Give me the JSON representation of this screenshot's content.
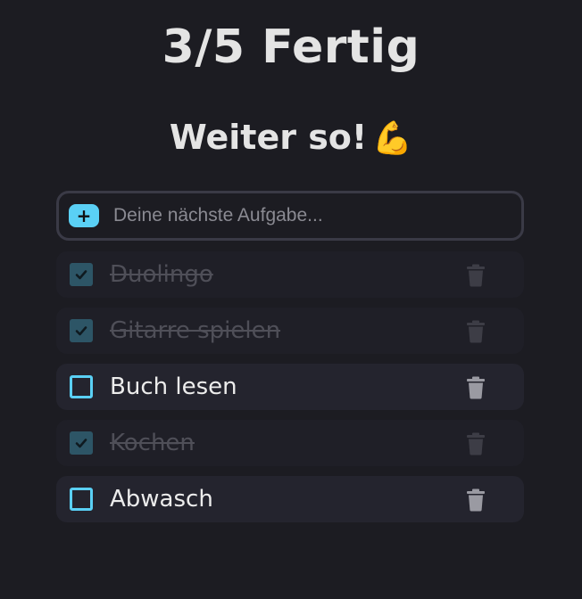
{
  "header": {
    "progress_text": "3/5 Fertig",
    "motivation_text": "Weiter so!",
    "motivation_emoji": "💪"
  },
  "add_task": {
    "button_label": "+",
    "placeholder": "Deine nächste Aufgabe..."
  },
  "tasks": [
    {
      "label": "Duolingo",
      "done": true
    },
    {
      "label": "Gitarre spielen",
      "done": true
    },
    {
      "label": "Buch lesen",
      "done": false
    },
    {
      "label": "Kochen",
      "done": true
    },
    {
      "label": "Abwasch",
      "done": false
    }
  ],
  "colors": {
    "background": "#1c1c22",
    "accent": "#5ad0f5",
    "checked_box": "#2d5566",
    "task_bg": "#24242e",
    "trash_active": "#9a9aa2",
    "trash_done": "#3d3d46"
  },
  "icons": {
    "add": "plus-icon",
    "check": "check-icon",
    "delete": "trash-icon"
  }
}
